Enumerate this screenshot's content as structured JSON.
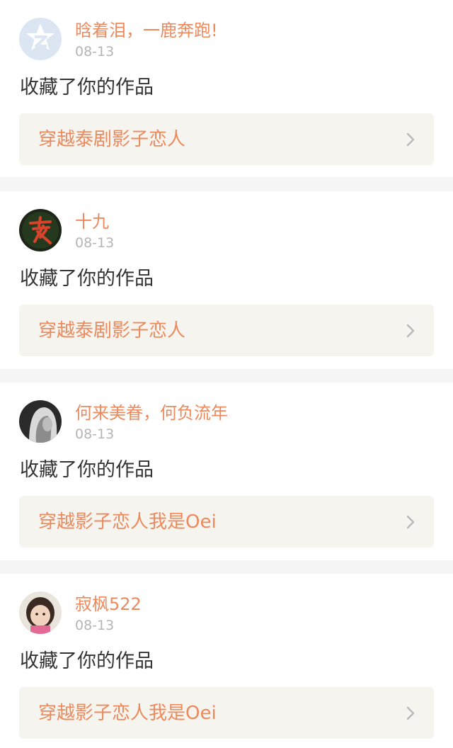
{
  "items": [
    {
      "username": "晗着泪，一鹿奔跑!",
      "date": "08-13",
      "action": "收藏了你的作品",
      "work_title": "穿越泰剧影子恋人",
      "avatar": "qzone-default-avatar"
    },
    {
      "username": "十九",
      "date": "08-13",
      "action": "收藏了你的作品",
      "work_title": "穿越泰剧影子恋人",
      "avatar": "red-calligraphy-avatar"
    },
    {
      "username": "何来美眷，何负流年",
      "date": "08-13",
      "action": "收藏了你的作品",
      "work_title": "穿越影子恋人我是Oei",
      "avatar": "grayscale-portrait-avatar"
    },
    {
      "username": "寂枫522",
      "date": "08-13",
      "action": "收藏了你的作品",
      "work_title": "穿越影子恋人我是Oei",
      "avatar": "child-photo-avatar"
    }
  ],
  "colors": {
    "accent": "#ec8a5e",
    "date": "#b5b5b5",
    "text": "#333333",
    "card_bg": "#ffffff",
    "work_bg": "#f6f4ee",
    "page_bg": "#f5f5f5"
  }
}
